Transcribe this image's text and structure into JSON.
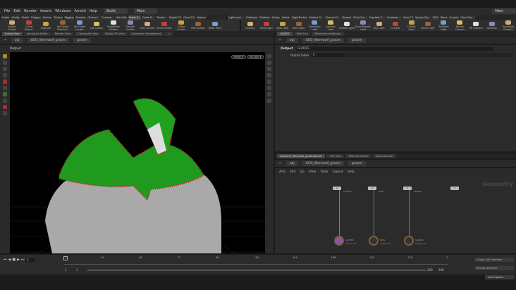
{
  "menu": [
    "File",
    "Edit",
    "Render",
    "Assets",
    "Windows",
    "Arnold",
    "Help"
  ],
  "desktop": "Build",
  "desktop_main": "Main",
  "right_desktop": "Main",
  "shelf_tabs_left": [
    "Create",
    "Modify",
    "Model",
    "Polygon",
    "Deform",
    "Texture",
    "Rigging",
    "Muscles",
    "Charact...",
    "Constrai...",
    "Hair Utils",
    "Guide P...",
    "Guide B...",
    "Terrain...",
    "Simple FX",
    "Cloud FX",
    "Volume"
  ],
  "shelf_tools_left": [
    "Isolate Guides",
    "Curve Advect",
    "Regrade",
    "Set Guide Direction",
    "Set Guide Length",
    "Lift Guides",
    "Straighten Guides",
    "Smooth Guides",
    "Frizz Guides",
    "Bend Guides",
    "Clump Guides",
    "Part Guides",
    "Make Hairs"
  ],
  "shelf_tabs_right": [
    "Lights and ...",
    "Collisions",
    "Particles",
    "Grains",
    "Vellum",
    "Rigid Bodies",
    "Particle Fl...",
    "Viscous Fl...",
    "Oceans",
    "Fluid Con...",
    "Populate C...",
    "Container ...",
    "Pyro FX",
    "Sparse Pyr...",
    "FEM",
    "Wires",
    "Crowds",
    "Drive Sim..."
  ],
  "shelf_tools_right": [
    "Camera",
    "Point Light",
    "Spot Light",
    "Area Light",
    "Geometry Light",
    "Volume Light",
    "Distant Light",
    "Environment Light",
    "Sky Light",
    "GI Light",
    "Caustic Light",
    "Portal Light",
    "Ambient Light",
    "Stereo Camera",
    "VR Camera",
    "Switcher",
    "Gamepad Camera"
  ],
  "left_pane_tabs": [
    "Scene View",
    "Animation Editor",
    "Render View",
    "Composite View",
    "Motion FX View",
    "Geometry Spreadsheet"
  ],
  "path": {
    "root": "obj",
    "geo": "GEO_Werewolf_groom",
    "node": "groom"
  },
  "viewport": {
    "label": "Output",
    "persp": "Persp ▾",
    "cam": "No cam ▾"
  },
  "param_tabs": [
    "GUIDES",
    "Take List",
    "Performance Monitor"
  ],
  "params": {
    "output_label": "Output",
    "output_value": "GUIDES",
    "index_label": "Output Index",
    "index_value": "0"
  },
  "net_tabs": [
    "/obj/GEO_Werewolf_groom/groom",
    "Tree View",
    "Material Palette",
    "Asset Browser"
  ],
  "net_menu": [
    "Add",
    "Edit",
    "Go",
    "View",
    "Tools",
    "Layout",
    "Help"
  ],
  "net_context": "Geometry",
  "inputs": [
    {
      "num": "1",
      "label": "GUIDES"
    },
    {
      "num": "2",
      "label": "SKIN"
    },
    {
      "num": "3",
      "label": "SKINGB"
    },
    {
      "num": "4",
      "label": ""
    }
  ],
  "outputs": [
    {
      "label": "GUIDES",
      "sub": "Output #0"
    },
    {
      "label": "SKIN",
      "sub": "Output #1"
    },
    {
      "label": "SKINGB",
      "sub": "Output #2"
    }
  ],
  "timeline": {
    "frame": "1",
    "ticks": [
      "24",
      "48",
      "72",
      "96",
      "120",
      "144",
      "168",
      "192",
      "216",
      "2"
    ],
    "start": "1",
    "start2": "1",
    "end": "240",
    "end2": "240",
    "keys": "0 keys, 0/0 channels",
    "key_all": "Key All Channels",
    "auto_update": "Auto Update"
  }
}
